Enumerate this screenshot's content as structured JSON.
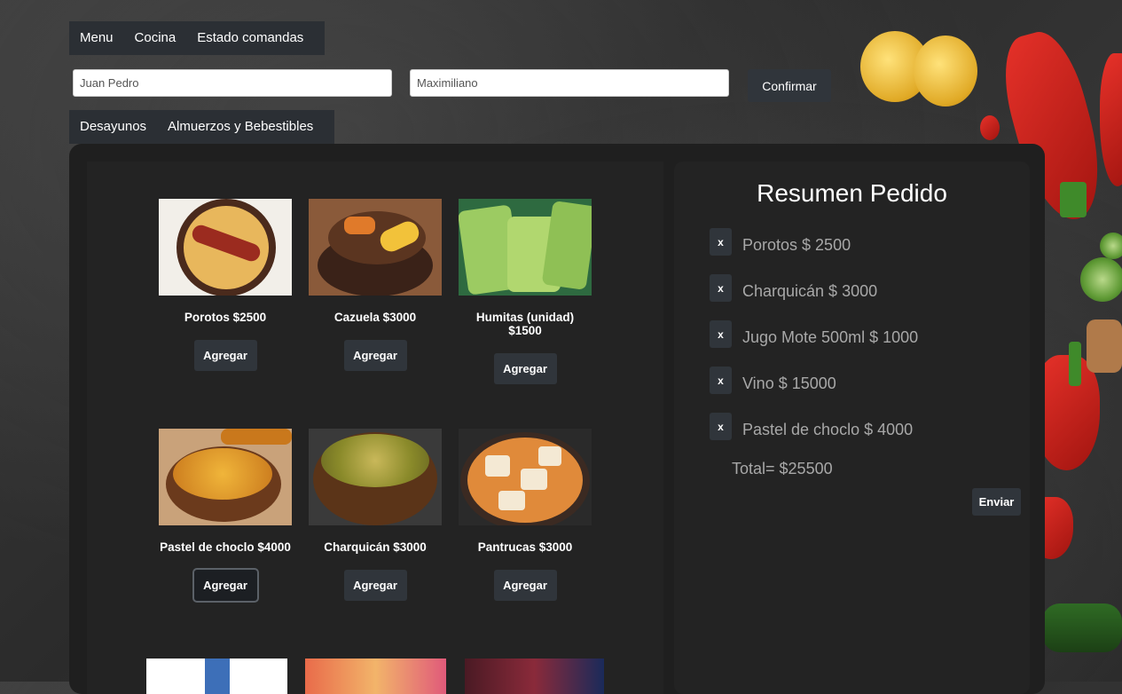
{
  "nav": {
    "items": [
      "Menu",
      "Cocina",
      "Estado comandas"
    ]
  },
  "form": {
    "field1_value": "Juan Pedro",
    "field2_value": "Maximiliano",
    "confirm_label": "Confirmar"
  },
  "categories": [
    "Desayunos",
    "Almuerzos y Bebestibles"
  ],
  "menu": {
    "items": [
      {
        "name": "Porotos $2500",
        "button": "Agregar"
      },
      {
        "name": "Cazuela $3000",
        "button": "Agregar"
      },
      {
        "name": "Humitas (unidad) $1500",
        "button": "Agregar"
      },
      {
        "name": "Pastel de choclo $4000",
        "button": "Agregar"
      },
      {
        "name": "Charquicán $3000",
        "button": "Agregar"
      },
      {
        "name": "Pantrucas $3000",
        "button": "Agregar"
      }
    ]
  },
  "summary": {
    "title": "Resumen Pedido",
    "remove_label": "x",
    "items": [
      "Porotos $ 2500",
      "Charquicán $ 3000",
      "Jugo Mote 500ml $ 1000",
      "Vino $ 15000",
      "Pastel de choclo $ 4000"
    ],
    "total": "Total= $25500",
    "send_label": "Enviar"
  },
  "colors": {
    "panel": "#232323",
    "button": "#30353b",
    "muted_text": "#a8a8a8"
  }
}
